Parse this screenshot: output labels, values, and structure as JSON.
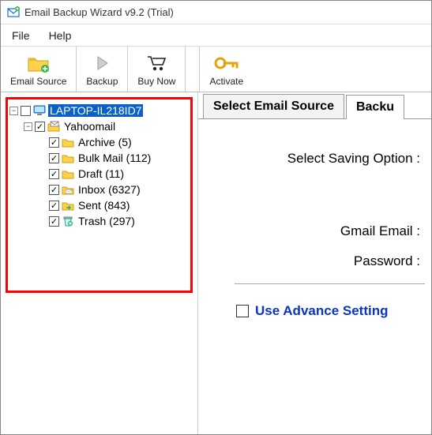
{
  "title": "Email Backup Wizard v9.2 (Trial)",
  "menu": {
    "file": "File",
    "help": "Help"
  },
  "toolbar": {
    "email_source": "Email Source",
    "backup": "Backup",
    "buy_now": "Buy Now",
    "activate": "Activate"
  },
  "tree": {
    "root": "LAPTOP-IL218ID7",
    "account": "Yahoomail",
    "folders": [
      {
        "name": "Archive",
        "count": 5
      },
      {
        "name": "Bulk Mail",
        "count": 112
      },
      {
        "name": "Draft",
        "count": 11
      },
      {
        "name": "Inbox",
        "count": 6327
      },
      {
        "name": "Sent",
        "count": 843
      },
      {
        "name": "Trash",
        "count": 297
      }
    ],
    "labels": {
      "archive": "Archive (5)",
      "bulk": "Bulk Mail (112)",
      "draft": "Draft (11)",
      "inbox": "Inbox (6327)",
      "sent": "Sent (843)",
      "trash": "Trash (297)"
    }
  },
  "tabs": {
    "select_source": "Select Email Source",
    "backup": "Backu"
  },
  "panel": {
    "saving_option": "Select Saving Option :",
    "gmail_email": "Gmail Email :",
    "password": "Password :",
    "advance": "Use Advance Setting"
  }
}
